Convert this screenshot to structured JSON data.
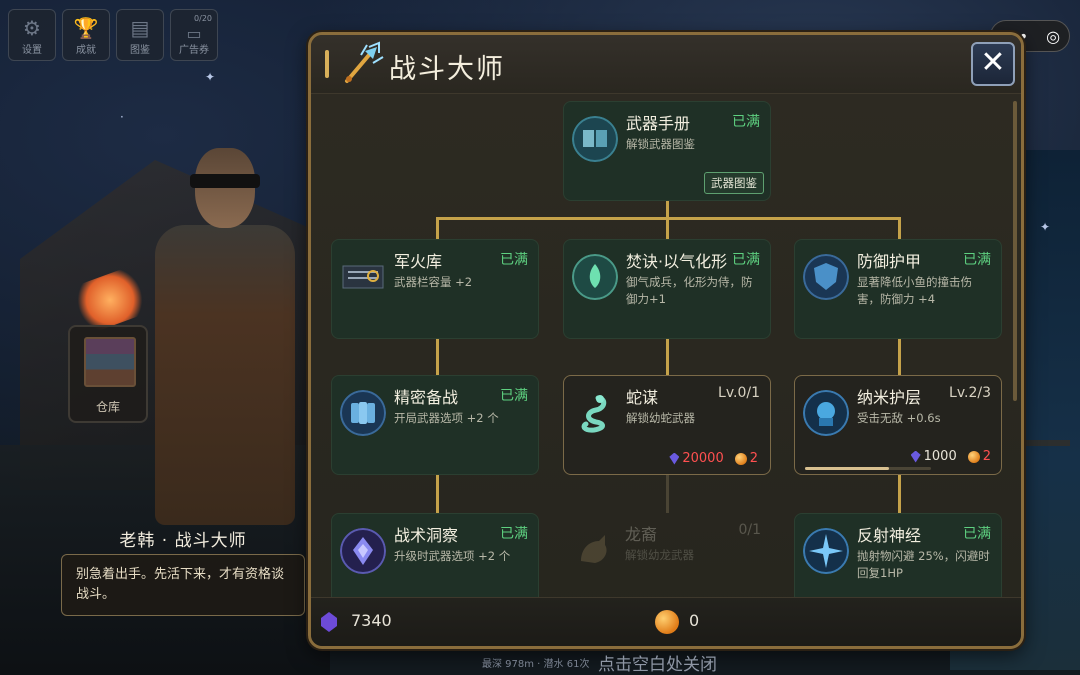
{
  "top_menu": [
    {
      "label": "设置",
      "icon": "gear-icon"
    },
    {
      "label": "成就",
      "icon": "trophy-icon"
    },
    {
      "label": "图鉴",
      "icon": "book-icon"
    },
    {
      "label": "广告券",
      "icon": "ticket-icon",
      "count": "0/20"
    }
  ],
  "npc": {
    "name": "老韩 · 战斗大师",
    "dialog": "别急着出手。先活下来，才有资格谈战斗。",
    "storage_label": "仓库"
  },
  "panel": {
    "title": "战斗大师",
    "close_symbol": "✕"
  },
  "skills": {
    "weapon_manual": {
      "name": "武器手册",
      "state": "已满",
      "desc": "解锁武器图鉴",
      "tag": "武器图鉴"
    },
    "armory": {
      "name": "军火库",
      "state": "已满",
      "desc": "武器栏容量 +2"
    },
    "burning_art": {
      "name": "焚诀·以气化形",
      "state": "已满",
      "desc": "御气成兵，化形为侍，防御力+1"
    },
    "defense_armor": {
      "name": "防御护甲",
      "state": "已满",
      "desc": "显著降低小鱼的撞击伤害，防御力 +4"
    },
    "precise_prep": {
      "name": "精密备战",
      "state": "已满",
      "desc": "开局武器选项 +2 个"
    },
    "snake_plan": {
      "name": "蛇谋",
      "level": "Lv.0/1",
      "desc": "解锁幼蛇武器",
      "gem_cost": "20000",
      "orb_cost": "2"
    },
    "nano_shield": {
      "name": "纳米护层",
      "level": "Lv.2/3",
      "desc": "受击无敌 +0.6s",
      "gem_cost": "1000",
      "orb_cost": "2",
      "progress": 0.67
    },
    "tactical_insight": {
      "name": "战术洞察",
      "state": "已满",
      "desc": "升级时武器选项 +2 个"
    },
    "dragon_heir": {
      "name": "龙裔",
      "level": "0/1",
      "desc": "解锁幼龙武器"
    },
    "reflex_nerve": {
      "name": "反射神经",
      "state": "已满",
      "desc": "抛射物闪避 25%，闪避时回复1HP"
    }
  },
  "currency": {
    "gems": "7340",
    "orbs": "0"
  },
  "capsule": {
    "more": "•••",
    "target": "◎"
  },
  "footer": {
    "info": "最深 978m · 潜水 61次",
    "hint": "点击空白处关闭"
  },
  "colors": {
    "accent_gold": "#c5a24a",
    "maxed_green": "#5ed080",
    "gem_red": "#ff5050",
    "gem_purple": "#6d4bd8"
  }
}
